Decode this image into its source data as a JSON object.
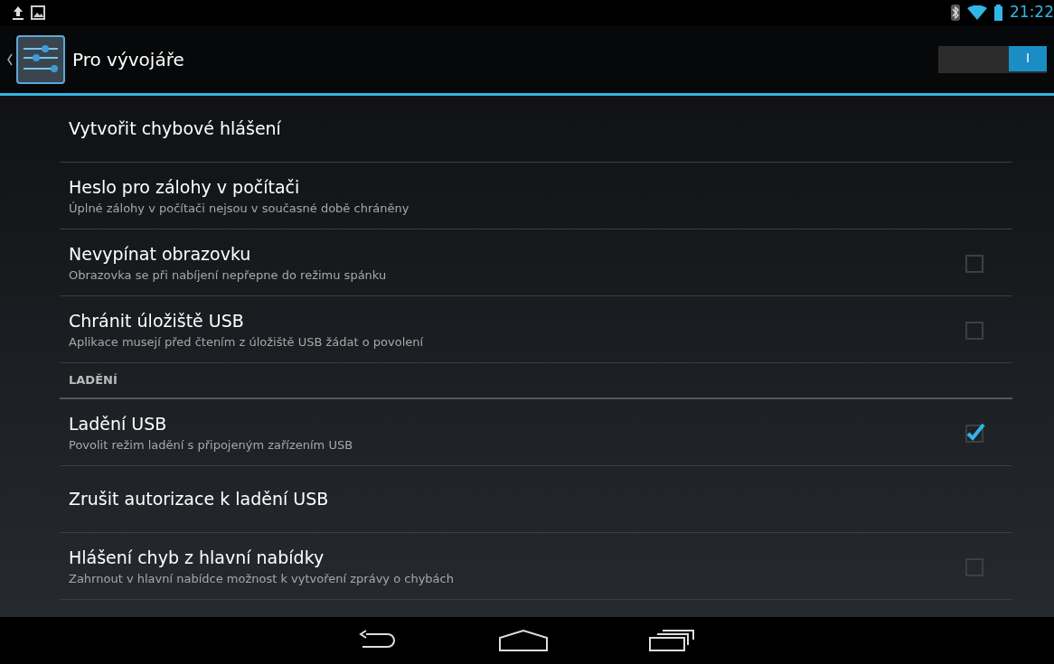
{
  "status_bar": {
    "time": "21:22"
  },
  "action_bar": {
    "title": "Pro vývojáře",
    "switch": {
      "label": "I",
      "on": true
    }
  },
  "items": [
    {
      "kind": "plain",
      "title": "Vytvořit chybové hlášení"
    },
    {
      "kind": "plain",
      "title": "Heslo pro zálohy v počítači",
      "summary": "Úplné zálohy v počítači nejsou v současné době chráněny"
    },
    {
      "kind": "checkbox",
      "title": "Nevypínat obrazovku",
      "summary": "Obrazovka se při nabíjení nepřepne do režimu spánku",
      "checked": false
    },
    {
      "kind": "checkbox",
      "title": "Chránit úložiště USB",
      "summary": "Aplikace musejí před čtením z úložiště USB žádat o povolení",
      "checked": false
    },
    {
      "kind": "header",
      "title": "LADĚNÍ"
    },
    {
      "kind": "checkbox",
      "title": "Ladění USB",
      "summary": "Povolit režim ladění s připojeným zařízením USB",
      "checked": true
    },
    {
      "kind": "plain",
      "title": "Zrušit autorizace k ladění USB"
    },
    {
      "kind": "checkbox",
      "title": "Hlášení chyb z hlavní nabídky",
      "summary": "Zahrnout v hlavní nabídce možnost k vytvoření zprávy o chybách",
      "checked": false
    }
  ]
}
